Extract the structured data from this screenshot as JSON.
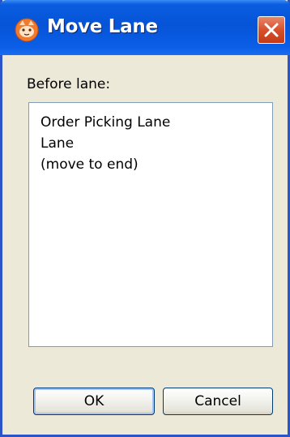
{
  "window": {
    "title": "Move Lane"
  },
  "icons": {
    "app_icon": "cat-face-icon",
    "close_icon": "close-icon"
  },
  "colors": {
    "titlebar": "#0654d8",
    "dialog_background": "#ece9d8",
    "close_button": "#d8502c",
    "list_border": "#7f9db9"
  },
  "dialog": {
    "before_label": "Before lane:",
    "lanes": [
      "Order Picking Lane",
      "Lane",
      "(move to end)"
    ],
    "ok_label": "OK",
    "cancel_label": "Cancel"
  }
}
